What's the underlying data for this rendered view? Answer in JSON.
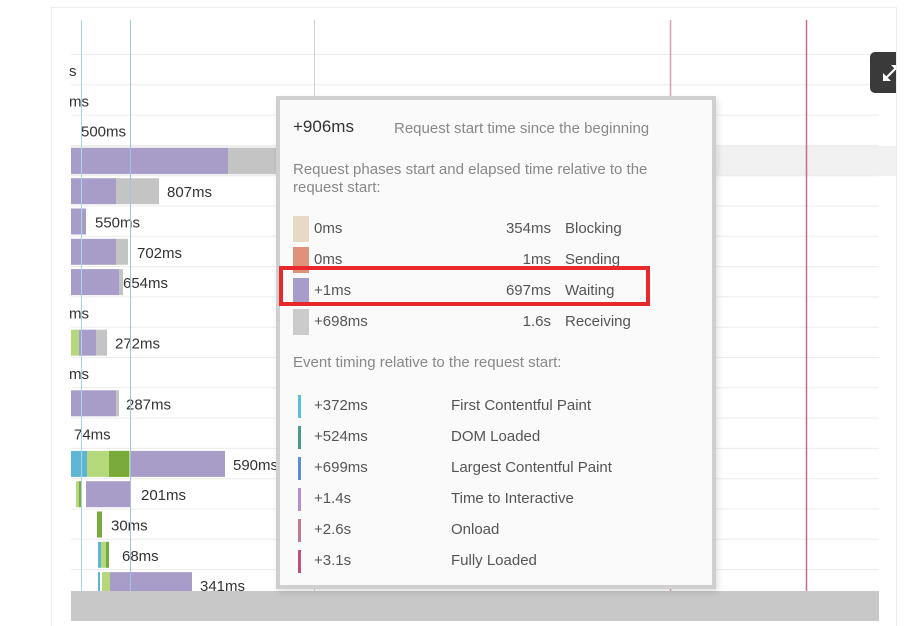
{
  "rows": [
    {
      "label": "s"
    },
    {
      "label": "ms"
    },
    {
      "label": "500ms"
    },
    {
      "label": ""
    },
    {
      "label": "807ms"
    },
    {
      "label": "550ms"
    },
    {
      "label": "702ms"
    },
    {
      "label": "654ms"
    },
    {
      "label": "ms"
    },
    {
      "label": "272ms"
    },
    {
      "label": "ms"
    },
    {
      "label": "287ms"
    },
    {
      "label": "74ms"
    },
    {
      "label": "590ms"
    },
    {
      "label": "201ms"
    },
    {
      "label": "30ms"
    },
    {
      "label": "68ms"
    },
    {
      "label": "341ms"
    }
  ],
  "expand_button": {
    "icon": "expand-arrows-icon"
  },
  "tooltip": {
    "start_value": "+906ms",
    "start_desc": "Request start time since the beginning",
    "phases_heading": "Request phases start and elapsed time relative to the request start:",
    "phases": [
      {
        "start": "0ms",
        "duration": "354ms",
        "name": "Blocking",
        "color": "#e8d9c4"
      },
      {
        "start": "0ms",
        "duration": "1ms",
        "name": "Sending",
        "color": "#e0917c"
      },
      {
        "start": "+1ms",
        "duration": "697ms",
        "name": "Waiting",
        "color": "#a89cc8"
      },
      {
        "start": "+698ms",
        "duration": "1.6s",
        "name": "Receiving",
        "color": "#cbcbcb"
      }
    ],
    "events_heading": "Event timing relative to the request start:",
    "events": [
      {
        "time": "+372ms",
        "name": "First Contentful Paint",
        "color": "#5bc0e0"
      },
      {
        "time": "+524ms",
        "name": "DOM Loaded",
        "color": "#4a9a8c"
      },
      {
        "time": "+699ms",
        "name": "Largest Contentful Paint",
        "color": "#5b8ed8"
      },
      {
        "time": "+1.4s",
        "name": "Time to Interactive",
        "color": "#b58fd0"
      },
      {
        "time": "+2.6s",
        "name": "Onload",
        "color": "#c07a98"
      },
      {
        "time": "+3.1s",
        "name": "Fully Loaded",
        "color": "#c0507a"
      }
    ]
  },
  "colors": {
    "waiting": "#a89cc8",
    "receiving": "#c4c4c4",
    "content_green": "#b5d87a",
    "content_dark_green": "#7aaa3a",
    "blue_marker": "#5fb6d4",
    "highlight": "#e8282b"
  }
}
